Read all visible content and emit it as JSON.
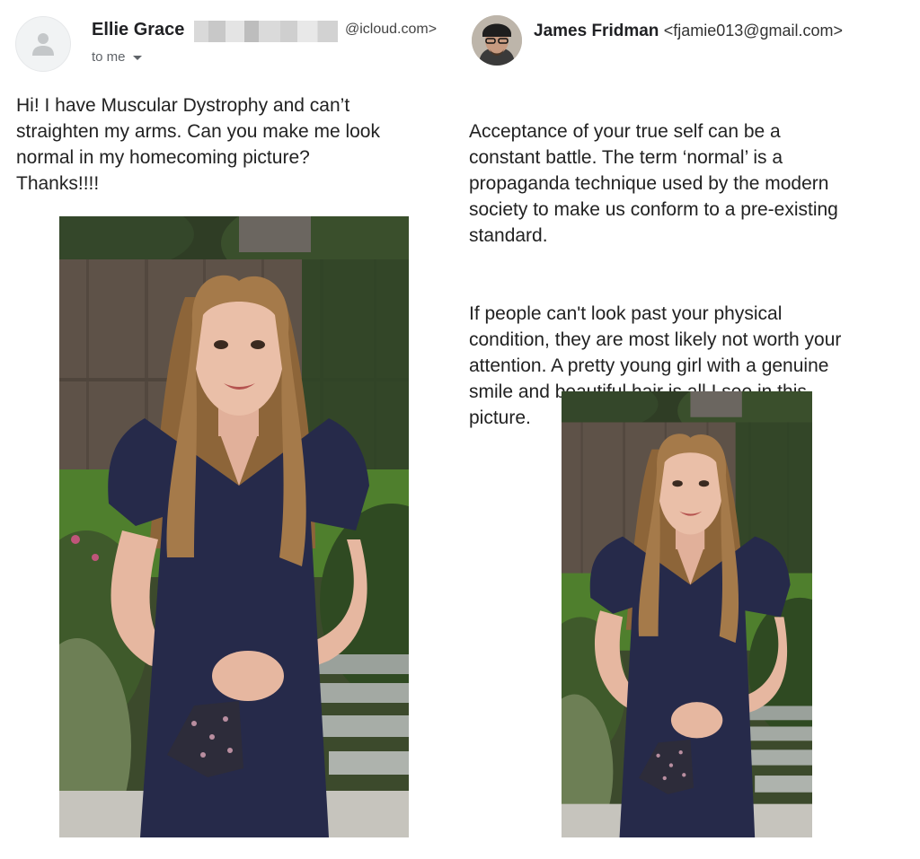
{
  "left_email": {
    "sender_name": "Ellie Grace",
    "sender_email_domain": "@icloud.com>",
    "recipient_label": "to me",
    "message": "Hi! I have Muscular Dystrophy and can’t\nstraighten my arms. Can you make me look\nnormal in my homecoming picture?\nThanks!!!!"
  },
  "right_email": {
    "sender_name": "James Fridman",
    "sender_email": "<fjamie013@gmail.com>",
    "paragraph_1": "Acceptance of your true self can be a\nconstant battle. The term ‘normal’ is a\npropaganda technique used by the modern\nsociety to make us conform to a pre-existing\nstandard.",
    "paragraph_2": "If people can't look past your physical\ncondition, they are most likely not worth your\nattention. A pretty young girl with a genuine\nsmile and beautiful hair is all I see in this\npicture."
  },
  "colors": {
    "dress": "#262a4a",
    "hair": "#a57a4a",
    "fence": "#5e5248",
    "grass": "#4f7f2d",
    "foliage": "#2f4a22"
  },
  "icons": [
    "default-avatar-icon",
    "dropdown-caret-icon"
  ]
}
